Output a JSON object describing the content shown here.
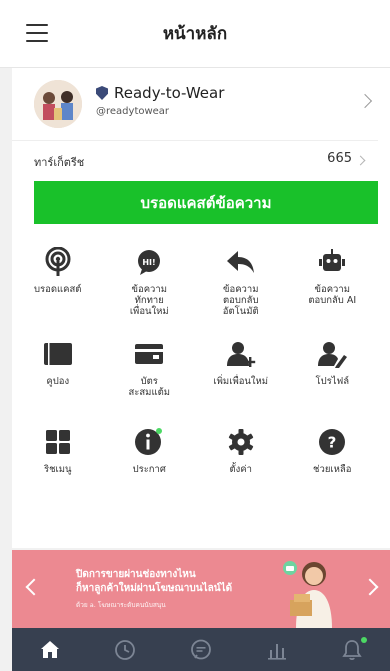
{
  "header": {
    "title": "หน้าหลัก"
  },
  "account": {
    "name": "Ready-to-Wear",
    "id": "@readytowear"
  },
  "friends": {
    "label": "ทาร์เก็ตรีช",
    "count": "665"
  },
  "broadcast": {
    "label": "บรอดแคสต์ข้อความ"
  },
  "features": [
    {
      "icon": "broadcast-icon",
      "label": "บรอดแคสต์"
    },
    {
      "icon": "hi-greeting-icon",
      "label": "ข้อความ\nทักทาย\nเพื่อนใหม่"
    },
    {
      "icon": "reply-icon",
      "label": "ข้อความ\nตอบกลับ\nอัตโนมัติ"
    },
    {
      "icon": "robot-icon",
      "label": "ข้อความ\nตอบกลับ AI"
    },
    {
      "icon": "coupon-icon",
      "label": "คูปอง"
    },
    {
      "icon": "wallet-icon",
      "label": "บัตร\nสะสมแต้ม"
    },
    {
      "icon": "add-friend-icon",
      "label": "เพิ่มเพื่อนใหม่"
    },
    {
      "icon": "profile-edit-icon",
      "label": "โปรไฟล์"
    },
    {
      "icon": "rich-menu-icon",
      "label": "ริชเมนู"
    },
    {
      "icon": "info-icon",
      "label": "ประกาศ"
    },
    {
      "icon": "settings-icon",
      "label": "ตั้งค่า"
    },
    {
      "icon": "help-icon",
      "label": "ช่วยเหลือ"
    }
  ],
  "banner": {
    "line1": "ปิดการขายผ่านช่องทางไหน",
    "line2": "ก็หาลูกค้าใหม่ผ่านโฆษณาบนไลน์ได้",
    "line3": "ด้วย a. โฆษณาระดับคนนับสนุน"
  },
  "tabs": [
    {
      "icon": "home-icon",
      "active": true
    },
    {
      "icon": "clock-icon",
      "active": false
    },
    {
      "icon": "chat-icon",
      "active": false
    },
    {
      "icon": "stats-icon",
      "active": false
    },
    {
      "icon": "bell-icon",
      "active": false
    }
  ],
  "colors": {
    "accent": "#19c12a",
    "banner": "#ec8991",
    "tabbar": "#374050"
  }
}
